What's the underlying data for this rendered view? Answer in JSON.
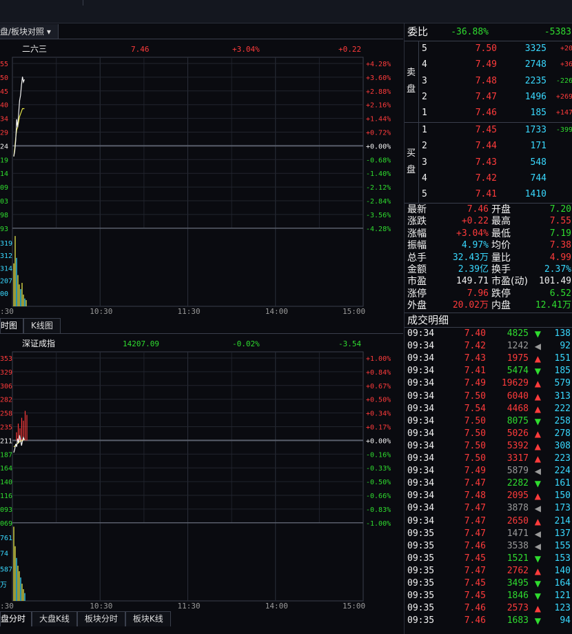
{
  "toolbar": {
    "dropdown_label": "盘/板块对照 ▾"
  },
  "chart_data": [
    {
      "type": "line",
      "title": "二六三",
      "price": "7.46",
      "change_pct": "+3.04%",
      "change": "+0.22",
      "left_ticks": [
        "55",
        "50",
        "45",
        "40",
        "34",
        "29",
        "24",
        "19",
        "14",
        "09",
        "03",
        "98",
        "93"
      ],
      "right_ticks": [
        "+4.28%",
        "+3.60%",
        "+2.88%",
        "+2.16%",
        "+1.44%",
        "+0.72%",
        "+0.00%",
        "-0.68%",
        "-1.40%",
        "-2.12%",
        "-2.84%",
        "-3.56%",
        "-4.28%"
      ],
      "volume_ticks": [
        "319",
        "312",
        "314",
        "207",
        "00"
      ],
      "x_ticks": [
        ":30",
        "10:30",
        "11:30",
        "14:00",
        "15:00"
      ],
      "prev_close": 7.24,
      "ylim": [
        6.93,
        7.55
      ],
      "price_series": [
        7.2,
        7.22,
        7.26,
        7.34,
        7.31,
        7.36,
        7.41,
        7.43,
        7.47,
        7.5,
        7.48,
        7.49
      ],
      "avg_series": [
        7.2,
        7.23,
        7.27,
        7.3,
        7.31,
        7.33,
        7.35,
        7.36,
        7.37,
        7.38,
        7.38,
        7.38
      ],
      "volume": [
        0.55,
        0.9,
        0.62,
        0.4,
        0.28,
        0.22,
        0.3,
        0.15,
        0.1,
        0.08
      ]
    },
    {
      "type": "line",
      "title": "深证成指",
      "price": "14207.09",
      "change_pct": "-0.02%",
      "change": "-3.54",
      "left_ticks": [
        "353",
        "329",
        "306",
        "282",
        "258",
        "235",
        "211",
        "187",
        "164",
        "140",
        "116",
        "093",
        "069"
      ],
      "right_ticks": [
        "+1.00%",
        "+0.84%",
        "+0.67%",
        "+0.50%",
        "+0.34%",
        "+0.17%",
        "+0.00%",
        "-0.16%",
        "-0.33%",
        "-0.50%",
        "-0.66%",
        "-0.83%",
        "-1.00%"
      ],
      "volume_ticks": [
        "761",
        "74",
        "587",
        "万"
      ],
      "x_ticks": [
        ":30",
        "10:30",
        "11:30",
        "14:00",
        "15:00"
      ],
      "prev_close": 14211,
      "ylim": [
        14069,
        14353
      ],
      "price_series": [
        14190,
        14196,
        14205,
        14200,
        14214,
        14206,
        14220,
        14213,
        14202,
        14210,
        14216,
        14212
      ],
      "avg_series": [
        14200,
        14201,
        14203,
        14204,
        14206,
        14207,
        14209,
        14210,
        14210,
        14211,
        14212,
        14212
      ],
      "bars_red": [
        14225,
        14240,
        14232,
        14250,
        14245,
        14262,
        14255
      ],
      "volume": [
        0.95,
        0.7,
        0.55,
        0.45,
        0.38,
        0.3,
        0.22,
        0.15,
        0.1
      ]
    }
  ],
  "tabs_top": [
    "时图",
    "K线图"
  ],
  "tabs_bottom": [
    "盘分时",
    "大盘K线",
    "板块分时",
    "板块K线"
  ],
  "order_book": {
    "weibi_label": "委比",
    "weibi_pct": "-36.88%",
    "weibi_val": "-5383",
    "sell_label_1": "卖",
    "sell_label_2": "盘",
    "buy_label_1": "买",
    "buy_label_2": "盘",
    "asks": [
      {
        "lvl": "5",
        "price": "7.50",
        "vol": "3325",
        "chg": "+20",
        "c": "red"
      },
      {
        "lvl": "4",
        "price": "7.49",
        "vol": "2748",
        "chg": "+36",
        "c": "red"
      },
      {
        "lvl": "3",
        "price": "7.48",
        "vol": "2235",
        "chg": "-226",
        "c": "green"
      },
      {
        "lvl": "2",
        "price": "7.47",
        "vol": "1496",
        "chg": "+269",
        "c": "red"
      },
      {
        "lvl": "1",
        "price": "7.46",
        "vol": "185",
        "chg": "+147",
        "c": "red"
      }
    ],
    "bids": [
      {
        "lvl": "1",
        "price": "7.45",
        "vol": "1733",
        "chg": "-399",
        "c": "green"
      },
      {
        "lvl": "2",
        "price": "7.44",
        "vol": "171",
        "chg": "",
        "c": "red"
      },
      {
        "lvl": "3",
        "price": "7.43",
        "vol": "548",
        "chg": "",
        "c": "red"
      },
      {
        "lvl": "4",
        "price": "7.42",
        "vol": "744",
        "chg": "",
        "c": "red"
      },
      {
        "lvl": "5",
        "price": "7.41",
        "vol": "1410",
        "chg": "",
        "c": "red"
      }
    ]
  },
  "quote": [
    {
      "l1": "最新",
      "v1": "7.46",
      "c1": "red",
      "l2": "开盘",
      "v2": "7.20",
      "c2": "green"
    },
    {
      "l1": "涨跌",
      "v1": "+0.22",
      "c1": "red",
      "l2": "最高",
      "v2": "7.55",
      "c2": "red"
    },
    {
      "l1": "涨幅",
      "v1": "+3.04%",
      "c1": "red",
      "l2": "最低",
      "v2": "7.19",
      "c2": "green"
    },
    {
      "l1": "振幅",
      "v1": "4.97%",
      "c1": "cyan",
      "l2": "均价",
      "v2": "7.38",
      "c2": "red"
    },
    {
      "l1": "总手",
      "v1": "32.43万",
      "c1": "cyan",
      "l2": "量比",
      "v2": "4.99",
      "c2": "red"
    },
    {
      "l1": "金额",
      "v1": "2.39亿",
      "c1": "cyan",
      "l2": "换手",
      "v2": "2.37%",
      "c2": "cyan"
    },
    {
      "l1": "市盈",
      "v1": "149.71",
      "c1": "white",
      "l2": "市盈(动)",
      "v2": "101.49",
      "c2": "white"
    },
    {
      "l1": "涨停",
      "v1": "7.96",
      "c1": "red",
      "l2": "跌停",
      "v2": "6.52",
      "c2": "green"
    },
    {
      "l1": "外盘",
      "v1": "20.02万",
      "c1": "red",
      "l2": "内盘",
      "v2": "12.41万",
      "c2": "green"
    }
  ],
  "trades_title": "成交明细",
  "trades": [
    {
      "t": "09:34",
      "p": "7.40",
      "v": "4825",
      "d": "down",
      "n": "138"
    },
    {
      "t": "09:34",
      "p": "7.42",
      "v": "1242",
      "d": "flat",
      "n": "92"
    },
    {
      "t": "09:34",
      "p": "7.43",
      "v": "1975",
      "d": "up",
      "n": "151"
    },
    {
      "t": "09:34",
      "p": "7.41",
      "v": "5474",
      "d": "down",
      "n": "185"
    },
    {
      "t": "09:34",
      "p": "7.49",
      "v": "19629",
      "d": "up",
      "n": "579"
    },
    {
      "t": "09:34",
      "p": "7.50",
      "v": "6040",
      "d": "up",
      "n": "313"
    },
    {
      "t": "09:34",
      "p": "7.54",
      "v": "4468",
      "d": "up",
      "n": "222"
    },
    {
      "t": "09:34",
      "p": "7.50",
      "v": "8075",
      "d": "down",
      "n": "258"
    },
    {
      "t": "09:34",
      "p": "7.50",
      "v": "5026",
      "d": "up",
      "n": "278"
    },
    {
      "t": "09:34",
      "p": "7.50",
      "v": "5392",
      "d": "up",
      "n": "308"
    },
    {
      "t": "09:34",
      "p": "7.50",
      "v": "3317",
      "d": "up",
      "n": "223"
    },
    {
      "t": "09:34",
      "p": "7.49",
      "v": "5879",
      "d": "flat",
      "n": "224"
    },
    {
      "t": "09:34",
      "p": "7.47",
      "v": "2282",
      "d": "down",
      "n": "161"
    },
    {
      "t": "09:34",
      "p": "7.48",
      "v": "2095",
      "d": "up",
      "n": "150"
    },
    {
      "t": "09:34",
      "p": "7.47",
      "v": "3878",
      "d": "flat",
      "n": "173"
    },
    {
      "t": "09:34",
      "p": "7.47",
      "v": "2650",
      "d": "up",
      "n": "214"
    },
    {
      "t": "09:35",
      "p": "7.47",
      "v": "1471",
      "d": "flat",
      "n": "137"
    },
    {
      "t": "09:35",
      "p": "7.46",
      "v": "3538",
      "d": "flat",
      "n": "155"
    },
    {
      "t": "09:35",
      "p": "7.45",
      "v": "1521",
      "d": "down",
      "n": "153"
    },
    {
      "t": "09:35",
      "p": "7.47",
      "v": "2762",
      "d": "up",
      "n": "140"
    },
    {
      "t": "09:35",
      "p": "7.45",
      "v": "3495",
      "d": "down",
      "n": "164"
    },
    {
      "t": "09:35",
      "p": "7.45",
      "v": "1846",
      "d": "down",
      "n": "121"
    },
    {
      "t": "09:35",
      "p": "7.46",
      "v": "2573",
      "d": "up",
      "n": "123"
    },
    {
      "t": "09:35",
      "p": "7.46",
      "v": "1683",
      "d": "down",
      "n": "94"
    }
  ]
}
